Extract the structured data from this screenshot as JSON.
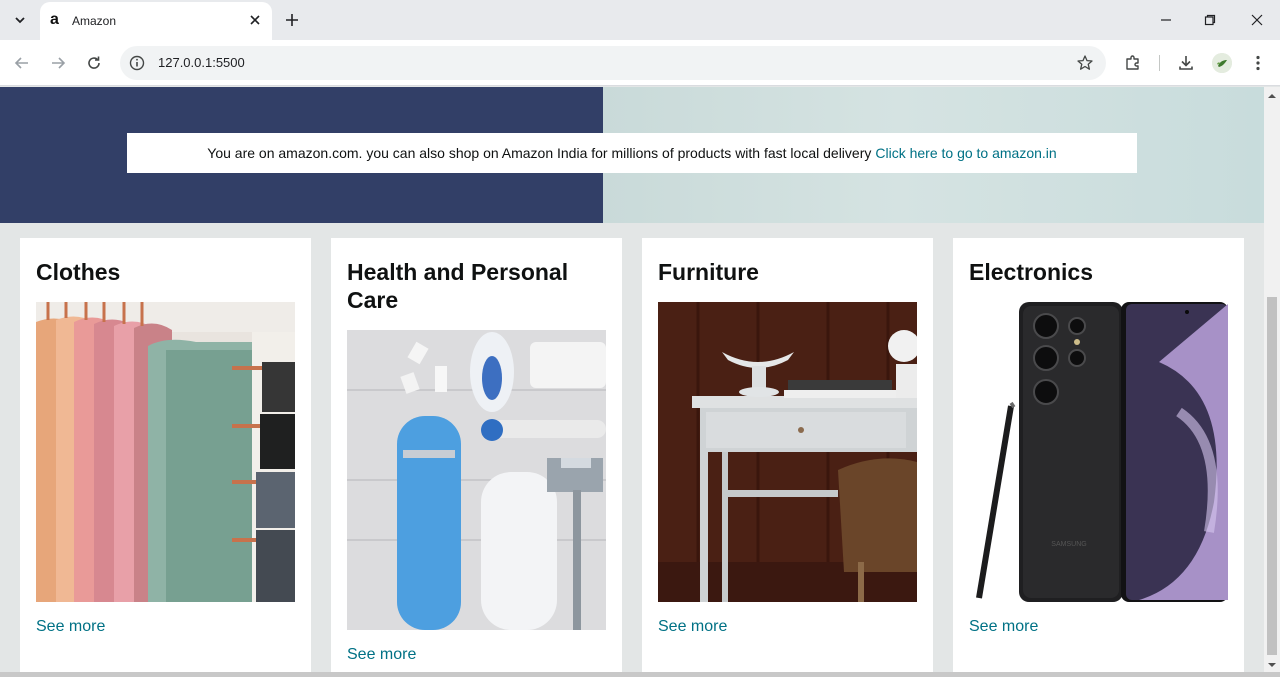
{
  "browser": {
    "tab_title": "Amazon",
    "tab_favicon": "a",
    "url": "127.0.0.1:5500"
  },
  "hero": {
    "notice_text": "You are on amazon.com. you can also shop on Amazon India for millions of products with fast local delivery",
    "notice_link": "Click here to go to amazon.in",
    "colors": {
      "left": "#323f67",
      "right": "#d0e0df"
    }
  },
  "cards": [
    {
      "title": "Clothes",
      "link": "See more"
    },
    {
      "title": "Health and Personal Care",
      "link": "See more"
    },
    {
      "title": "Furniture",
      "link": "See more"
    },
    {
      "title": "Electronics",
      "link": "See more",
      "phone_brand": "SAMSUNG"
    }
  ],
  "colors": {
    "link": "#007185",
    "page_bg": "#e3e6e6"
  }
}
